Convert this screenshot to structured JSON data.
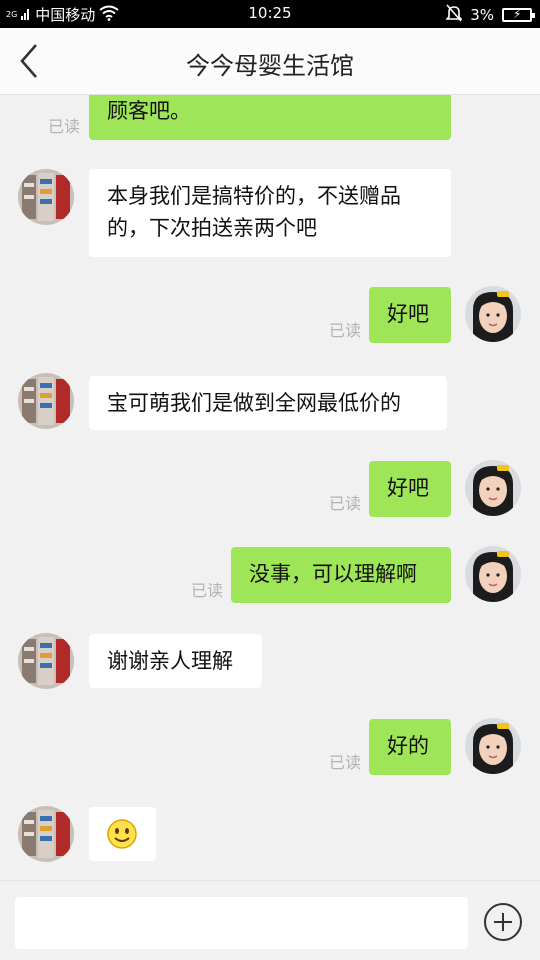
{
  "status_bar": {
    "network_type": "2G",
    "carrier": "中国移动",
    "time": "10:25",
    "battery": "3%"
  },
  "header": {
    "title": "今今母婴生活馆"
  },
  "messages": [
    {
      "side": "right",
      "text": "顾客吧。",
      "read": "已读"
    },
    {
      "side": "left",
      "text": "本身我们是搞特价的，不送赠品的，下次拍送亲两个吧"
    },
    {
      "side": "right",
      "text": "好吧",
      "read": "已读"
    },
    {
      "side": "left",
      "text": "宝可萌我们是做到全网最低价的"
    },
    {
      "side": "right",
      "text": "好吧",
      "read": "已读"
    },
    {
      "side": "right",
      "text": "没事，可以理解啊",
      "read": "已读"
    },
    {
      "side": "left",
      "text": "谢谢亲人理解"
    },
    {
      "side": "right",
      "text": "好的",
      "read": "已读"
    },
    {
      "side": "left",
      "emoji": "smiley-face-icon"
    }
  ],
  "input": {
    "value": "",
    "placeholder": ""
  },
  "colors": {
    "bubble_sent": "#9ee657",
    "bubble_received": "#ffffff",
    "background": "#f1f1f1",
    "read_receipt": "#b3b3b3"
  }
}
